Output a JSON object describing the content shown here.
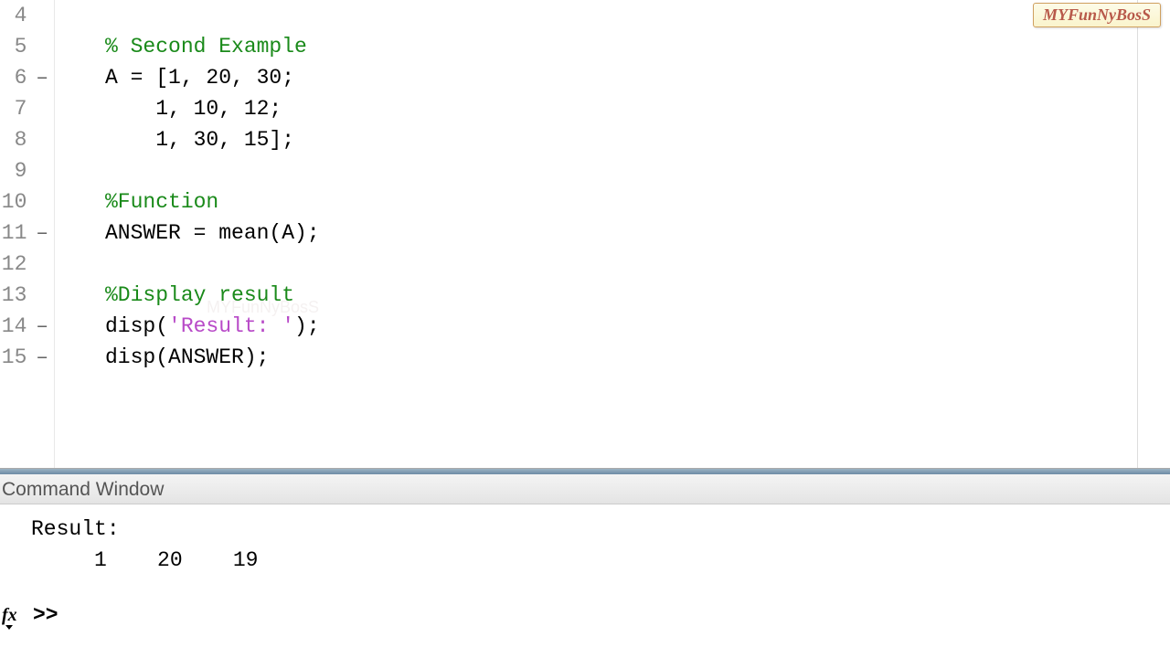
{
  "watermark": "MYFunNyBosS",
  "gutter": [
    {
      "n": "4",
      "dash": ""
    },
    {
      "n": "5",
      "dash": ""
    },
    {
      "n": "6",
      "dash": "–"
    },
    {
      "n": "7",
      "dash": ""
    },
    {
      "n": "8",
      "dash": ""
    },
    {
      "n": "9",
      "dash": ""
    },
    {
      "n": "10",
      "dash": ""
    },
    {
      "n": "11",
      "dash": "–"
    },
    {
      "n": "12",
      "dash": ""
    },
    {
      "n": "13",
      "dash": ""
    },
    {
      "n": "14",
      "dash": "–"
    },
    {
      "n": "15",
      "dash": "–"
    }
  ],
  "code": {
    "l4": "",
    "l5": "% Second Example",
    "l6": "A = [1, 20, 30;",
    "l7": "    1, 10, 12;",
    "l8": "    1, 30, 15];",
    "l9": "",
    "l10": "%Function",
    "l11": "ANSWER = mean(A);",
    "l12": "",
    "l13": "%Display result",
    "l14a": "disp(",
    "l14b": "'Result: '",
    "l14c": ");",
    "l15": "disp(ANSWER);"
  },
  "command_window": {
    "title": "Command Window",
    "out1": "Result:",
    "out2": "     1    20    19",
    "fx": "fx",
    "prompt": ">>"
  },
  "ghost": "MYFunNyBosS"
}
